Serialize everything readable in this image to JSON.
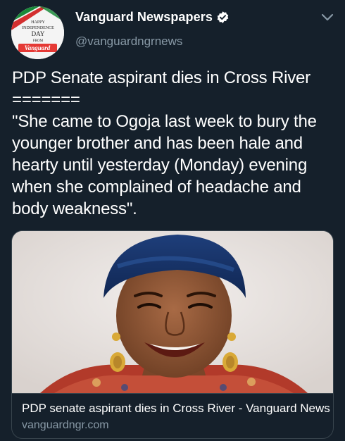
{
  "tweet": {
    "author": {
      "display_name": "Vanguard Newspapers",
      "handle": "@vanguardngrnews",
      "verified": true,
      "avatar": {
        "line1": "HAPPY",
        "line2": "INDEPENDENCE",
        "line3": "DAY",
        "line4": "FROM",
        "brand": "Vanguard"
      }
    },
    "text": "PDP Senate aspirant dies in Cross River\n=======\n\"She came to Ogoja last week to bury the younger brother and has been hale and hearty until yesterday (Monday) evening when she complained of headache and body weakness\".",
    "card": {
      "title": "PDP senate aspirant dies in Cross River - Vanguard News",
      "domain": "vanguardngr.com"
    }
  },
  "icons": {
    "verified": "verified-badge-icon",
    "menu": "chevron-down-icon"
  },
  "colors": {
    "background": "#15202b",
    "secondary_text": "#8899a6",
    "border": "#38444d",
    "verified": "#ffffff"
  }
}
